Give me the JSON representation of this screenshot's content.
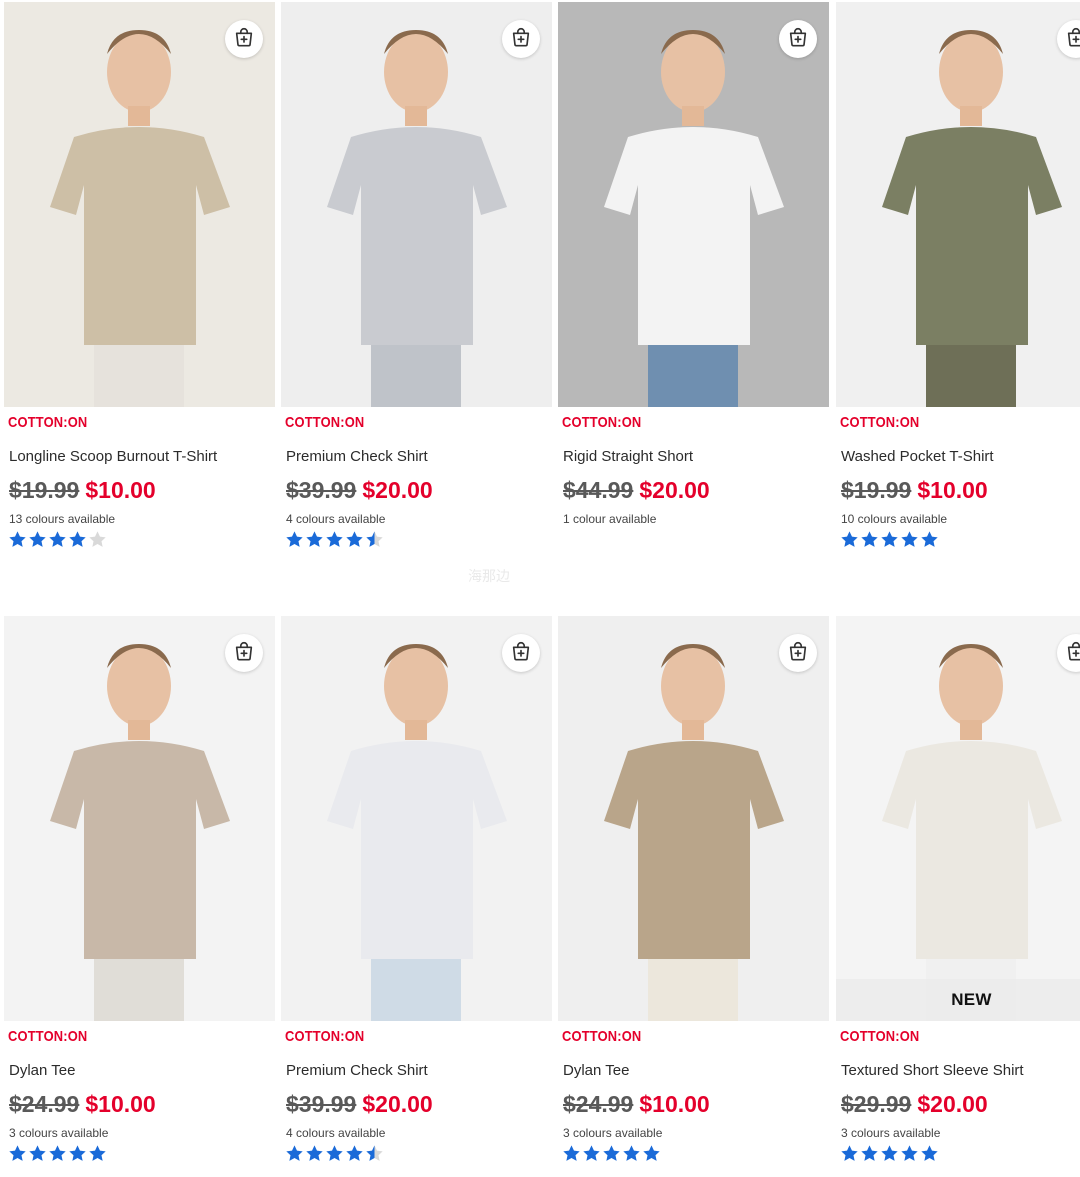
{
  "brand_colors": {
    "sale": "#e4002b",
    "star": "#1a6ad8",
    "star_empty": "#d9d9d9"
  },
  "products": [
    {
      "brand": "COTTON:ON",
      "name": "Longline Scoop Burnout T-Shirt",
      "was_price": "$19.99",
      "now_price": "$10.00",
      "colours": "13 colours available",
      "rating": 4,
      "badge": "",
      "icon": "add-to-bag-icon",
      "image_tone": "#ece9e2"
    },
    {
      "brand": "COTTON:ON",
      "name": "Premium Check Shirt",
      "was_price": "$39.99",
      "now_price": "$20.00",
      "colours": "4 colours available",
      "rating": 4.5,
      "badge": "",
      "icon": "add-to-bag-icon",
      "image_tone": "#eeeeee"
    },
    {
      "brand": "COTTON:ON",
      "name": "Rigid Straight Short",
      "was_price": "$44.99",
      "now_price": "$20.00",
      "colours": "1 colour available",
      "rating": null,
      "badge": "",
      "icon": "add-to-bag-icon",
      "image_tone": "#b8b8b8"
    },
    {
      "brand": "COTTON:ON",
      "name": "Washed Pocket T-Shirt",
      "was_price": "$19.99",
      "now_price": "$10.00",
      "colours": "10 colours available",
      "rating": 5,
      "badge": "",
      "icon": "add-to-bag-icon",
      "image_tone": "#f0f0f0"
    },
    {
      "brand": "COTTON:ON",
      "name": "Dylan Tee",
      "was_price": "$24.99",
      "now_price": "$10.00",
      "colours": "3 colours available",
      "rating": 5,
      "badge": "",
      "icon": "add-to-bag-icon",
      "image_tone": "#f3f3f3"
    },
    {
      "brand": "COTTON:ON",
      "name": "Premium Check Shirt",
      "was_price": "$39.99",
      "now_price": "$20.00",
      "colours": "4 colours available",
      "rating": 4.5,
      "badge": "",
      "icon": "add-to-bag-icon",
      "image_tone": "#f2f2f2"
    },
    {
      "brand": "COTTON:ON",
      "name": "Dylan Tee",
      "was_price": "$24.99",
      "now_price": "$10.00",
      "colours": "3 colours available",
      "rating": 5,
      "badge": "",
      "icon": "add-to-bag-icon",
      "image_tone": "#efefef"
    },
    {
      "brand": "COTTON:ON",
      "name": "Textured Short Sleeve Shirt",
      "was_price": "$29.99",
      "now_price": "$20.00",
      "colours": "3 colours available",
      "rating": 5,
      "badge": "NEW",
      "icon": "add-to-bag-icon",
      "image_tone": "#f4f4f4"
    }
  ],
  "watermark": "海那边"
}
